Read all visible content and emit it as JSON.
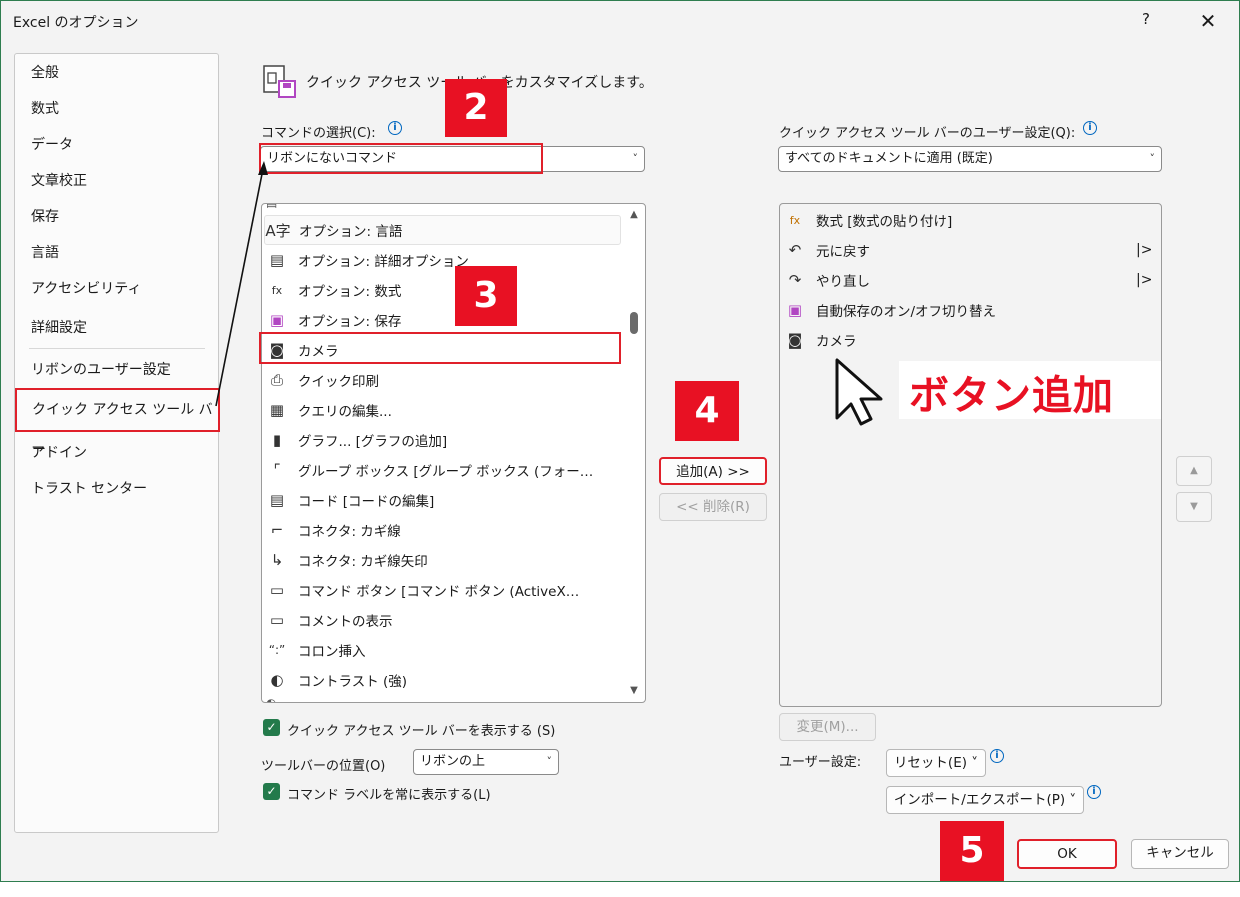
{
  "window": {
    "title": "Excel のオプション",
    "help": "?",
    "close": "✕"
  },
  "nav": {
    "items": [
      {
        "label": "全般"
      },
      {
        "label": "数式"
      },
      {
        "label": "データ"
      },
      {
        "label": "文章校正"
      },
      {
        "label": "保存"
      },
      {
        "label": "言語"
      },
      {
        "label": "アクセシビリティ"
      },
      {
        "label": "詳細設定"
      },
      {
        "label": "リボンのユーザー設定"
      },
      {
        "label": "クイック アクセス ツール バー"
      },
      {
        "label": "アドイン"
      },
      {
        "label": "トラスト センター"
      }
    ],
    "selected": "クイック アクセス ツール バー"
  },
  "header": {
    "text": "クイック アクセス ツール バーをカスタマイズします。"
  },
  "left": {
    "command_label": "コマンドの選択(C):",
    "command_value": "リボンにないコマンド",
    "items": [
      {
        "icon": "language-icon",
        "glyph": "A字",
        "label": "オプション: 言語"
      },
      {
        "icon": "advanced-options-icon",
        "glyph": "▤",
        "label": "オプション: 詳細オプション"
      },
      {
        "icon": "formula-options-icon",
        "glyph": "fx",
        "label": "オプション: 数式"
      },
      {
        "icon": "save-icon",
        "glyph": "▣",
        "label": "オプション: 保存"
      },
      {
        "icon": "camera-icon",
        "glyph": "◙",
        "label": "カメラ"
      },
      {
        "icon": "quick-print-icon",
        "glyph": "⎙",
        "label": "クイック印刷"
      },
      {
        "icon": "query-edit-icon",
        "glyph": "▦",
        "label": "クエリの編集..."
      },
      {
        "icon": "chart-icon",
        "glyph": "▮",
        "label": "グラフ... [グラフの追加]"
      },
      {
        "icon": "group-box-icon",
        "glyph": "⌜",
        "label": "グループ ボックス [グループ ボックス (フォー…"
      },
      {
        "icon": "code-icon",
        "glyph": "▤",
        "label": "コード [コードの編集]"
      },
      {
        "icon": "elbow-connector-icon",
        "glyph": "⌐",
        "label": "コネクタ: カギ線"
      },
      {
        "icon": "elbow-arrow-connector-icon",
        "glyph": "↳",
        "label": "コネクタ: カギ線矢印"
      },
      {
        "icon": "command-button-icon",
        "glyph": "▭",
        "label": "コマンド ボタン [コマンド ボタン (ActiveX…"
      },
      {
        "icon": "comment-icon",
        "glyph": "▭",
        "label": "コメントの表示"
      },
      {
        "icon": "colon-insert-icon",
        "glyph": "“:”",
        "label": "コロン挿入"
      },
      {
        "icon": "contrast-icon",
        "glyph": "◐",
        "label": "コントラスト (強)"
      }
    ]
  },
  "middle": {
    "add_label": "追加(A) >>",
    "remove_label": "<< 削除(R)"
  },
  "right": {
    "scope_label": "クイック アクセス ツール バーのユーザー設定(Q):",
    "scope_value": "すべてのドキュメントに適用 (既定)",
    "items": [
      {
        "icon": "paste-formula-icon",
        "glyph": "fx",
        "label": "数式 [数式の貼り付け]",
        "submenu": false
      },
      {
        "icon": "undo-icon",
        "glyph": "↶",
        "label": "元に戻す",
        "submenu": true
      },
      {
        "icon": "redo-icon",
        "glyph": "↷",
        "label": "やり直し",
        "submenu": true
      },
      {
        "icon": "autosave-icon",
        "glyph": "▣",
        "label": "自動保存のオン/オフ切り替え",
        "submenu": false
      },
      {
        "icon": "camera-icon",
        "glyph": "◙",
        "label": "カメラ",
        "submenu": false
      }
    ],
    "submenu_mark": "|>",
    "modify_label": "変更(M)...",
    "custom_label": "ユーザー設定:",
    "reset_label": "リセット(E) ˅",
    "import_export_label": "インポート/エクスポート(P) ˅"
  },
  "options": {
    "show_qat_label": "クイック アクセス ツール バーを表示する (S)",
    "toolbar_position_label": "ツールバーの位置(O)",
    "toolbar_position_value": "リボンの上",
    "always_label_label": "コマンド ラベルを常に表示する(L)"
  },
  "footer": {
    "ok_label": "OK",
    "cancel_label": "キャンセル"
  },
  "annotations": {
    "step2": "2",
    "step3": "3",
    "step4": "4",
    "step5": "5",
    "callout": "ボタン追加"
  },
  "colors": {
    "accent_red": "#e81123",
    "check_green": "#237a4b"
  }
}
